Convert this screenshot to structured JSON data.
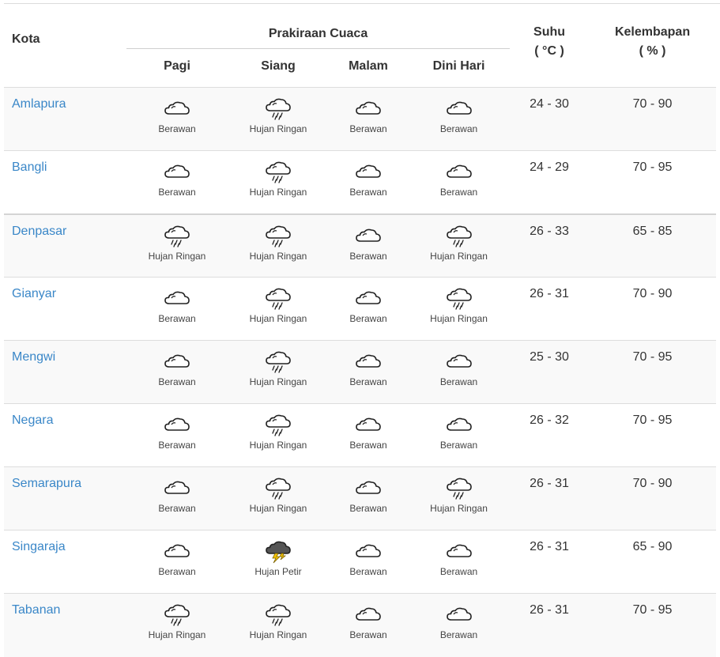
{
  "header": {
    "city_label": "Kota",
    "forecast_label": "Prakiraan Cuaca",
    "periods": [
      "Pagi",
      "Siang",
      "Malam",
      "Dini Hari"
    ],
    "temp_label": "Suhu",
    "temp_unit": "( °C )",
    "humidity_label": "Kelembapan",
    "humidity_unit": "( % )"
  },
  "rows": [
    {
      "city": "Amlapura",
      "wx": [
        {
          "icon": "cloud-icon",
          "label": "Berawan"
        },
        {
          "icon": "light-rain-icon",
          "label": "Hujan Ringan"
        },
        {
          "icon": "cloud-icon",
          "label": "Berawan"
        },
        {
          "icon": "cloud-icon",
          "label": "Berawan"
        }
      ],
      "temp": "24 - 30",
      "humidity": "70 - 90"
    },
    {
      "city": "Bangli",
      "wx": [
        {
          "icon": "cloud-icon",
          "label": "Berawan"
        },
        {
          "icon": "light-rain-icon",
          "label": "Hujan Ringan"
        },
        {
          "icon": "cloud-icon",
          "label": "Berawan"
        },
        {
          "icon": "cloud-icon",
          "label": "Berawan"
        }
      ],
      "temp": "24 - 29",
      "humidity": "70 - 95"
    },
    {
      "city": "Denpasar",
      "wx": [
        {
          "icon": "light-rain-icon",
          "label": "Hujan Ringan"
        },
        {
          "icon": "light-rain-icon",
          "label": "Hujan Ringan"
        },
        {
          "icon": "cloud-icon",
          "label": "Berawan"
        },
        {
          "icon": "light-rain-icon",
          "label": "Hujan Ringan"
        }
      ],
      "temp": "26 - 33",
      "humidity": "65 - 85"
    },
    {
      "city": "Gianyar",
      "wx": [
        {
          "icon": "cloud-icon",
          "label": "Berawan"
        },
        {
          "icon": "light-rain-icon",
          "label": "Hujan Ringan"
        },
        {
          "icon": "cloud-icon",
          "label": "Berawan"
        },
        {
          "icon": "light-rain-icon",
          "label": "Hujan Ringan"
        }
      ],
      "temp": "26 - 31",
      "humidity": "70 - 90"
    },
    {
      "city": "Mengwi",
      "wx": [
        {
          "icon": "cloud-icon",
          "label": "Berawan"
        },
        {
          "icon": "light-rain-icon",
          "label": "Hujan Ringan"
        },
        {
          "icon": "cloud-icon",
          "label": "Berawan"
        },
        {
          "icon": "cloud-icon",
          "label": "Berawan"
        }
      ],
      "temp": "25 - 30",
      "humidity": "70 - 95"
    },
    {
      "city": "Negara",
      "wx": [
        {
          "icon": "cloud-icon",
          "label": "Berawan"
        },
        {
          "icon": "light-rain-icon",
          "label": "Hujan Ringan"
        },
        {
          "icon": "cloud-icon",
          "label": "Berawan"
        },
        {
          "icon": "cloud-icon",
          "label": "Berawan"
        }
      ],
      "temp": "26 - 32",
      "humidity": "70 - 95"
    },
    {
      "city": "Semarapura",
      "wx": [
        {
          "icon": "cloud-icon",
          "label": "Berawan"
        },
        {
          "icon": "light-rain-icon",
          "label": "Hujan Ringan"
        },
        {
          "icon": "cloud-icon",
          "label": "Berawan"
        },
        {
          "icon": "light-rain-icon",
          "label": "Hujan Ringan"
        }
      ],
      "temp": "26 - 31",
      "humidity": "70 - 90"
    },
    {
      "city": "Singaraja",
      "wx": [
        {
          "icon": "cloud-icon",
          "label": "Berawan"
        },
        {
          "icon": "thunderstorm-icon",
          "label": "Hujan Petir"
        },
        {
          "icon": "cloud-icon",
          "label": "Berawan"
        },
        {
          "icon": "cloud-icon",
          "label": "Berawan"
        }
      ],
      "temp": "26 - 31",
      "humidity": "65 - 90"
    },
    {
      "city": "Tabanan",
      "wx": [
        {
          "icon": "light-rain-icon",
          "label": "Hujan Ringan"
        },
        {
          "icon": "light-rain-icon",
          "label": "Hujan Ringan"
        },
        {
          "icon": "cloud-icon",
          "label": "Berawan"
        },
        {
          "icon": "cloud-icon",
          "label": "Berawan"
        }
      ],
      "temp": "26 - 31",
      "humidity": "70 - 95"
    }
  ],
  "colors": {
    "link": "#3a87c8",
    "stripe": "#f9f9f9",
    "storm_cloud": "#555555",
    "lightning": "#f2c200"
  }
}
